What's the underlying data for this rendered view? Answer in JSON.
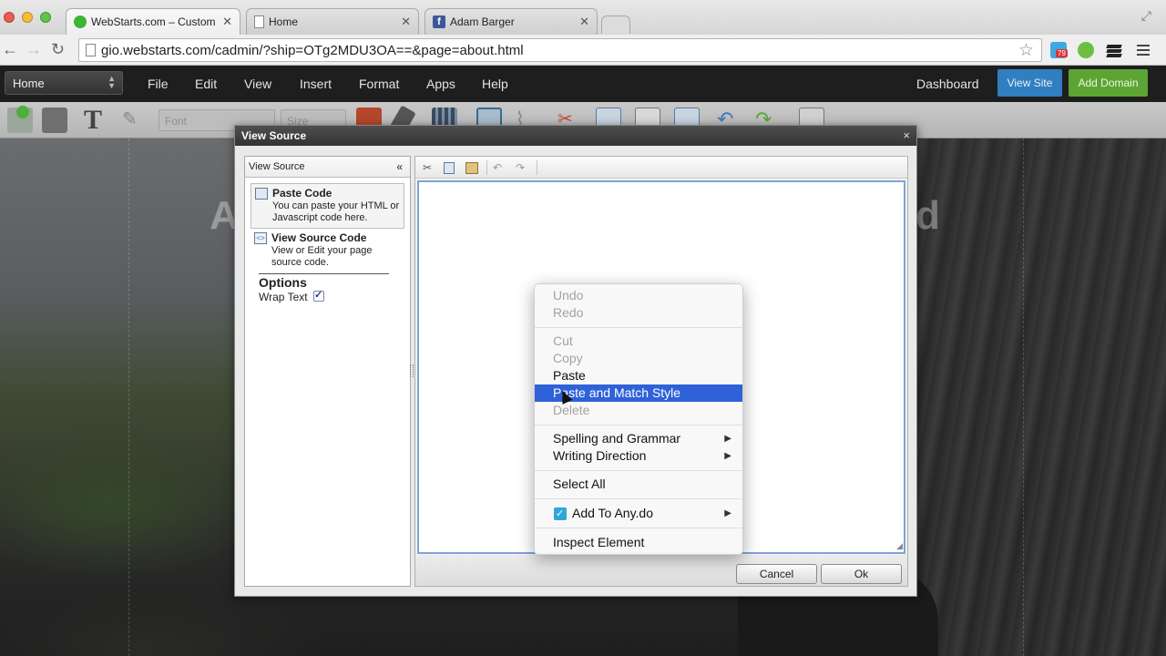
{
  "browser": {
    "tabs": [
      {
        "title": "WebStarts.com – Custom W",
        "favicon": "green-circle-icon"
      },
      {
        "title": "Home",
        "favicon": "page-icon"
      },
      {
        "title": "Adam Barger",
        "favicon": "facebook-icon"
      }
    ],
    "url": "gio.webstarts.com/cadmin/?ship=OTg2MDU3OA==&page=about.html",
    "extension_badge": "79",
    "accent_colors": {
      "close": "#ee5a50",
      "minimize": "#f6bd3b",
      "zoom": "#5fc44b"
    }
  },
  "app_bar": {
    "page_select_value": "Home",
    "menu": [
      "File",
      "Edit",
      "View",
      "Insert",
      "Format",
      "Apps",
      "Help"
    ],
    "dashboard_label": "Dashboard",
    "view_site_label": "View Site",
    "add_domain_label": "Add Domain",
    "colors": {
      "view_site": "#2f7fc1",
      "add_domain": "#5ca534"
    }
  },
  "toolbar": {
    "font_placeholder": "Font",
    "size_placeholder": "Size"
  },
  "background_text": {
    "left": "A",
    "right": "d"
  },
  "dialog": {
    "title": "View Source",
    "close_glyph": "×",
    "left_panel": {
      "header": "View Source",
      "collapse_glyph": "«",
      "paste_code": {
        "title": "Paste Code",
        "description": "You can paste your HTML or Javascript code here."
      },
      "view_source_code": {
        "title": "View Source Code",
        "description": "View or Edit your page source code."
      },
      "options_title": "Options",
      "wrap_text_label": "Wrap Text",
      "wrap_text_checked": true
    },
    "cancel_label": "Cancel",
    "ok_label": "Ok"
  },
  "context_menu": {
    "items": {
      "undo": "Undo",
      "redo": "Redo",
      "cut": "Cut",
      "copy": "Copy",
      "paste": "Paste",
      "paste_match": "Paste and Match Style",
      "delete": "Delete",
      "spelling": "Spelling and Grammar",
      "writing": "Writing Direction",
      "select_all": "Select All",
      "anydo": "Add To Any.do",
      "inspect": "Inspect Element"
    },
    "highlight_color": "#2f62d8",
    "submenu_glyph": "▶"
  }
}
